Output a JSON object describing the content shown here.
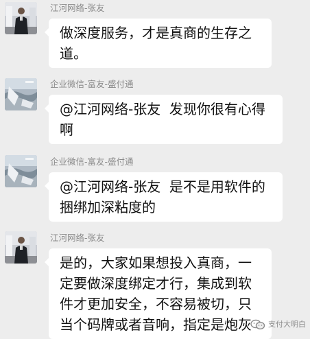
{
  "messages": [
    {
      "sender": "江河网络-张友",
      "avatar": "person-portrait-avatar",
      "text": "做深度服务，才是真商的生存之道。"
    },
    {
      "sender": "企业微信-富友-盛付通",
      "avatar": "waterside-scenery-avatar",
      "text": "@江河网络-张友  发现你很有心得啊"
    },
    {
      "sender": "企业微信-富友-盛付通",
      "avatar": "waterside-scenery-avatar",
      "text": "@江河网络-张友  是不是用软件的捆绑加深粘度的"
    },
    {
      "sender": "江河网络-张友",
      "avatar": "person-portrait-avatar",
      "text": "是的，大家如果想投入真商，一定要做深度绑定才行，集成到软件才更加安全，不容易被切，只当个码牌或者音响，指定是炮灰"
    }
  ],
  "watermark": {
    "icon": "wechat-channel-icon",
    "text": "支付大明白"
  }
}
